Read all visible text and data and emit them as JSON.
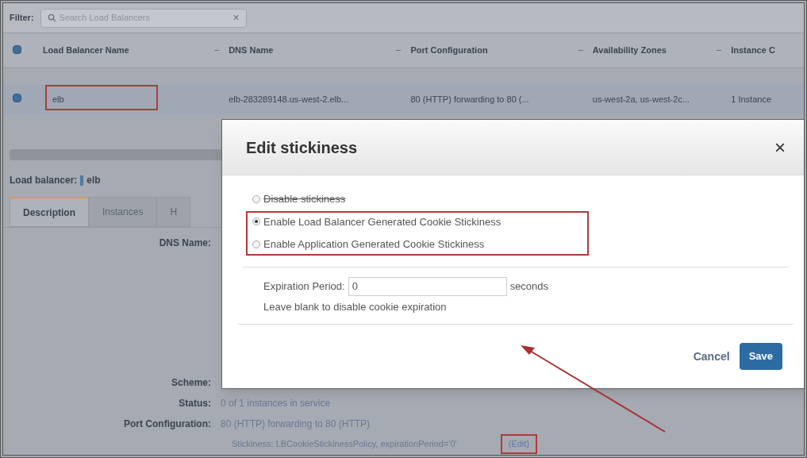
{
  "filter": {
    "label": "Filter:",
    "placeholder": "Search Load Balancers",
    "clear": "×"
  },
  "table": {
    "select_all_checked": true,
    "columns": [
      "Load Balancer Name",
      "DNS Name",
      "Port Configuration",
      "Availability Zones",
      "Instance C"
    ],
    "rows": [
      {
        "checked": true,
        "cells": [
          "elb",
          "elb-283289148.us-west-2.elb...",
          "80 (HTTP) forwarding to 80 (...",
          "us-west-2a, us-west-2c...",
          "1 Instance"
        ]
      }
    ]
  },
  "detail": {
    "label": "Load balancer:",
    "name": "elb",
    "tabs": [
      {
        "label": "Description",
        "selected": true
      },
      {
        "label": "Instances",
        "selected": false
      },
      {
        "label": "H",
        "selected": false
      }
    ],
    "fields": [
      {
        "label": "DNS Name:"
      },
      {
        "label": "Scheme:"
      },
      {
        "label": "Status:",
        "value": "0 of 1 instances in service"
      },
      {
        "label": "Port Configuration:",
        "value": "80 (HTTP) forwarding to 80 (HTTP)",
        "sub": "Stickiness: LBCookieStickinessPolicy, expirationPeriod='0'",
        "link": "(Edit)"
      }
    ]
  },
  "dialog": {
    "title": "Edit stickiness",
    "close": "×",
    "options": [
      {
        "label": "Disable stickiness",
        "selected": false
      },
      {
        "label": "Enable Load Balancer Generated Cookie Stickiness",
        "selected": true
      },
      {
        "label": "Enable Application Generated Cookie Stickiness",
        "selected": false
      }
    ],
    "expiration": {
      "label": "Expiration Period:",
      "value": "0",
      "unit": "seconds",
      "hint": "Leave blank to disable cookie expiration"
    },
    "buttons": [
      "Cancel",
      "Save"
    ]
  }
}
